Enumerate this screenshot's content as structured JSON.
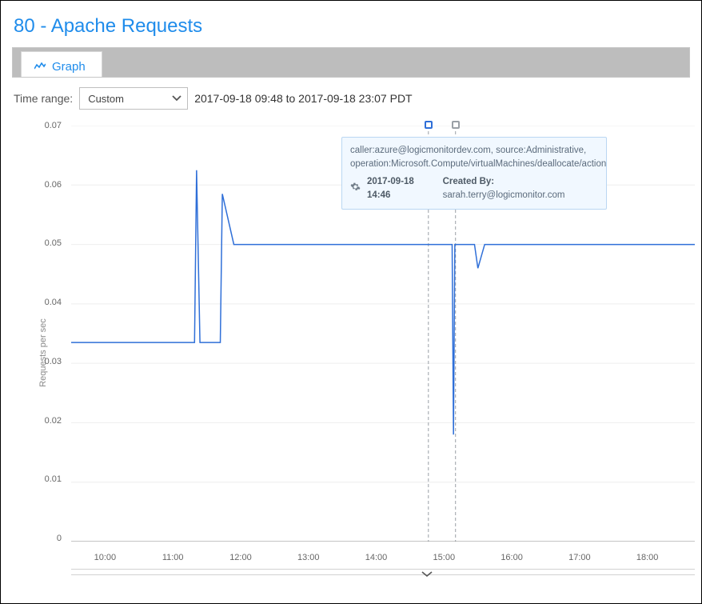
{
  "title": "80 - Apache Requests",
  "tab": {
    "label": "Graph"
  },
  "timerange": {
    "label": "Time range:",
    "selected": "Custom",
    "text": "2017-09-18 09:48 to 2017-09-18 23:07 PDT"
  },
  "ylabel": "Requests per sec",
  "yticks": [
    "0.07",
    "0.06",
    "0.05",
    "0.04",
    "0.03",
    "0.02",
    "0.01",
    "0"
  ],
  "xticks": [
    "10:00",
    "11:00",
    "12:00",
    "13:00",
    "14:00",
    "15:00",
    "16:00",
    "17:00",
    "18:00"
  ],
  "tooltip": {
    "line1": "caller:azure@logicmonitordev.com, source:Administrative, operation:Microsoft.Compute/virtualMachines/deallocate/action",
    "timestamp": "2017-09-18 14:46",
    "created_by_label": "Created By:",
    "created_by": "sarah.terry@logicmonitor.com"
  },
  "markers": [
    {
      "time": "14:46",
      "type": "active"
    },
    {
      "time": "15:10",
      "type": "gray"
    }
  ],
  "chart_data": {
    "type": "line",
    "xlabel": "",
    "ylabel": "Requests per sec",
    "x_range_hours": [
      9.5,
      18.7
    ],
    "ylim": [
      0,
      0.07
    ],
    "series": [
      {
        "name": "Requests per sec",
        "color": "#2f6fd8",
        "points": [
          {
            "t": 9.5,
            "v": 0.0335
          },
          {
            "t": 11.32,
            "v": 0.0335
          },
          {
            "t": 11.35,
            "v": 0.0625
          },
          {
            "t": 11.4,
            "v": 0.0335
          },
          {
            "t": 11.7,
            "v": 0.0335
          },
          {
            "t": 11.73,
            "v": 0.0585
          },
          {
            "t": 11.9,
            "v": 0.05
          },
          {
            "t": 15.12,
            "v": 0.05
          },
          {
            "t": 15.14,
            "v": 0.018
          },
          {
            "t": 15.16,
            "v": 0.05
          },
          {
            "t": 15.45,
            "v": 0.05
          },
          {
            "t": 15.5,
            "v": 0.046
          },
          {
            "t": 15.6,
            "v": 0.05
          },
          {
            "t": 18.7,
            "v": 0.05
          }
        ]
      }
    ],
    "annotations": [
      {
        "t": 14.77,
        "style": "dashed"
      },
      {
        "t": 15.17,
        "style": "dashed"
      }
    ]
  }
}
